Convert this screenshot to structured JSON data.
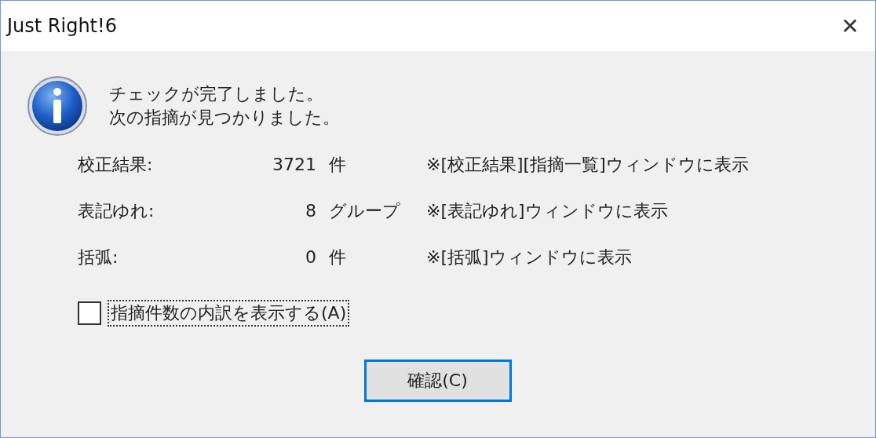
{
  "window": {
    "title": "Just Right!6",
    "close": "✕"
  },
  "message": [
    "チェックが完了しました。",
    "次の指摘が見つかりました。"
  ],
  "results": [
    {
      "label": "校正結果:",
      "count": "3721",
      "unit": "件",
      "note": "※[校正結果][指摘一覧]ウィンドウに表示"
    },
    {
      "label": "表記ゆれ:",
      "count": "8",
      "unit": "グループ",
      "note": "※[表記ゆれ]ウィンドウに表示"
    },
    {
      "label": "括弧:",
      "count": "0",
      "unit": "件",
      "note": "※[括弧]ウィンドウに表示"
    }
  ],
  "checkbox": {
    "label": "指摘件数の内訳を表示する(A)",
    "checked": false,
    "focused": true
  },
  "button": {
    "label": "確認(C)",
    "default": true
  }
}
